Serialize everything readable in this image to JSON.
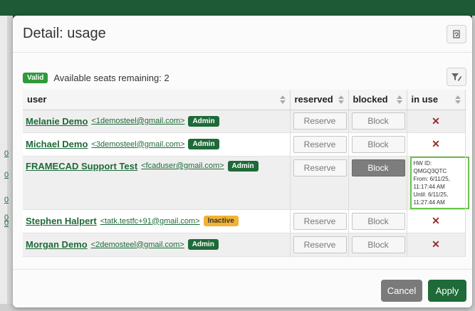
{
  "background": {
    "side_links": [
      "0",
      "0",
      "0",
      "0",
      "0"
    ]
  },
  "dialog": {
    "title": "Detail: usage",
    "refresh_icon": "refresh-icon",
    "filter_icon": "filter-edit-icon"
  },
  "status": {
    "badge": "Valid",
    "seats_text": "Available seats remaining: 2"
  },
  "table": {
    "columns": [
      "user",
      "reserved",
      "blocked",
      "in use"
    ],
    "rows": [
      {
        "name": "Melanie Demo",
        "email": "<1demosteel@gmail.com>",
        "role": "Admin",
        "reserve_label": "Reserve",
        "block_label": "Block",
        "in_use": "✕"
      },
      {
        "name": "Michael Demo",
        "email": "<3demosteel@gmail.com>",
        "role": "Admin",
        "reserve_label": "Reserve",
        "block_label": "Block",
        "in_use": "✕"
      },
      {
        "name": "FRAMECAD Support Test",
        "email": "<fcaduser@gmail.com>",
        "role": "Admin",
        "reserve_label": "Reserve",
        "block_label": "Block",
        "in_use_details": {
          "hw_id": "HW ID: QMGQ3QTC",
          "from": "From: 6/11/25,",
          "from_time": "11:17:44 AM",
          "until": "Until: 6/11/25,",
          "until_time": "11:27:44 AM"
        }
      },
      {
        "name": "Stephen Halpert",
        "email": "<tatk.testfc+91@gmail.com>",
        "role": "Inactive",
        "reserve_label": "Reserve",
        "block_label": "Block",
        "in_use": "✕"
      },
      {
        "name": "Morgan Demo",
        "email": "<2demosteel@gmail.com>",
        "role": "Admin",
        "reserve_label": "Reserve",
        "block_label": "Block",
        "in_use": "✕"
      }
    ]
  },
  "footer": {
    "cancel_label": "Cancel",
    "apply_label": "Apply"
  },
  "colors": {
    "brand_green": "#1e6a38",
    "valid_green": "#2e9a3a",
    "inactive_amber": "#f2b233",
    "highlight_green": "#6cc24a"
  }
}
